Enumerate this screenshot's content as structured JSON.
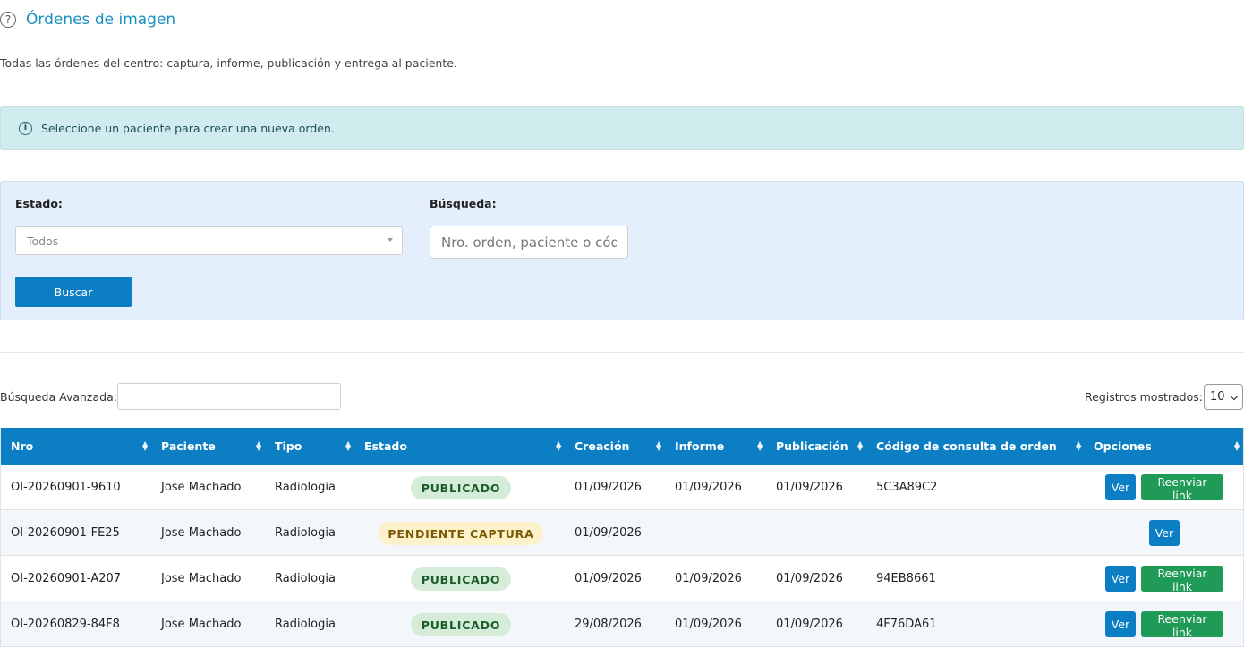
{
  "header": {
    "title": "Órdenes de imagen",
    "help_icon": "?"
  },
  "subtitle": "Todas las órdenes del centro: captura, informe, publicación y entrega al paciente.",
  "alert": {
    "icon": "i",
    "text": "Seleccione un paciente para crear una nueva orden."
  },
  "filters": {
    "estado_label": "Estado:",
    "estado_value": "Todos",
    "busqueda_label": "Búsqueda:",
    "busqueda_placeholder": "Nro. orden, paciente o código",
    "buscar_label": "Buscar"
  },
  "table_controls": {
    "advanced_label": "Búsqueda Avanzada:",
    "records_label": "Registros mostrados:",
    "records_value": "10"
  },
  "table": {
    "headers": [
      "Nro",
      "Paciente",
      "Tipo",
      "Estado",
      "Creación",
      "Informe",
      "Publicación",
      "Código de consulta de orden",
      "Opciones"
    ],
    "rows": [
      {
        "nro": "OI-20260901-9610",
        "paciente": "Jose Machado",
        "tipo": "Radiologia",
        "estado": "PUBLICADO",
        "creacion": "01/09/2026",
        "informe": "01/09/2026",
        "publicacion": "01/09/2026",
        "codigo": "5C3A89C2",
        "ver": "Ver",
        "reenviar": "Reenviar link"
      },
      {
        "nro": "OI-20260901-FE25",
        "paciente": "Jose Machado",
        "tipo": "Radiologia",
        "estado": "PENDIENTE CAPTURA",
        "creacion": "01/09/2026",
        "informe": "—",
        "publicacion": "—",
        "codigo": "",
        "ver": "Ver"
      },
      {
        "nro": "OI-20260901-A207",
        "paciente": "Jose Machado",
        "tipo": "Radiologia",
        "estado": "PUBLICADO",
        "creacion": "01/09/2026",
        "informe": "01/09/2026",
        "publicacion": "01/09/2026",
        "codigo": "94EB8661",
        "ver": "Ver",
        "reenviar": "Reenviar link"
      },
      {
        "nro": "OI-20260829-84F8",
        "paciente": "Jose Machado",
        "tipo": "Radiologia",
        "estado": "PUBLICADO",
        "creacion": "29/08/2026",
        "informe": "01/09/2026",
        "publicacion": "01/09/2026",
        "codigo": "4F76DA61",
        "ver": "Ver",
        "reenviar": "Reenviar link"
      }
    ]
  },
  "colors": {
    "primary": "#0c7fc4",
    "success": "#1f9a57",
    "badge_published_bg": "#d5ecd9",
    "badge_pending_bg": "#fdf1c9"
  }
}
